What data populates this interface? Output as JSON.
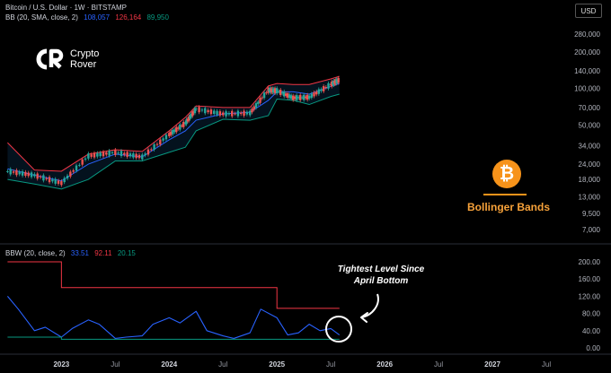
{
  "header": {
    "symbol": "Bitcoin / U.S. Dollar · 1W · BITSTAMP",
    "bb_label": "BB (20, SMA, close, 2)",
    "bb_values": [
      "108,057",
      "126,164",
      "89,950"
    ],
    "currency": "USD"
  },
  "logo": {
    "line1": "Crypto",
    "line2": "Rover"
  },
  "badge": {
    "title": "Bollinger Bands",
    "icon": "bitcoin-icon"
  },
  "annotation": {
    "line1": "Tightest Level Since",
    "line2": "April Bottom"
  },
  "colors": {
    "basis": "#2962ff",
    "upper": "#f23645",
    "lower": "#089981",
    "bbw": "#2962ff",
    "orange": "#f7931a"
  },
  "chart_data": [
    {
      "type": "line",
      "title": "Bitcoin / U.S. Dollar · 1W · BITSTAMP",
      "scale": "log",
      "y_ticks": [
        7000,
        9500,
        13000,
        18000,
        24000,
        34000,
        50000,
        70000,
        100000,
        140000,
        200000,
        280000
      ],
      "y_tick_labels": [
        "7,000",
        "9,500",
        "13,000",
        "18,000",
        "24,000",
        "34,000",
        "50,000",
        "70,000",
        "100,000",
        "140,000",
        "200,000",
        "280,000"
      ],
      "x_tick_labels": [
        "2023",
        "Jul",
        "2024",
        "Jul",
        "2025",
        "Jul",
        "2026",
        "Jul",
        "2027",
        "Jul"
      ],
      "x": [
        2022.5,
        2022.75,
        2023.0,
        2023.25,
        2023.5,
        2023.75,
        2024.0,
        2024.15,
        2024.25,
        2024.5,
        2024.75,
        2024.92,
        2025.0,
        2025.15,
        2025.3,
        2025.5,
        2025.58
      ],
      "series": [
        {
          "name": "close",
          "values": [
            21000,
            19500,
            16800,
            28000,
            30000,
            27500,
            42000,
            52000,
            68000,
            62000,
            63000,
            97000,
            96000,
            84000,
            85000,
            108000,
            118000
          ]
        },
        {
          "name": "BB basis",
          "values": [
            22000,
            19500,
            17500,
            24000,
            29000,
            27500,
            38000,
            45000,
            55000,
            62000,
            64000,
            80000,
            94000,
            94000,
            90000,
            104000,
            110000
          ]
        },
        {
          "name": "BB upper",
          "values": [
            36000,
            21500,
            21000,
            29000,
            31500,
            30500,
            45000,
            58000,
            72000,
            70000,
            70000,
            105000,
            110000,
            108000,
            108000,
            120000,
            126000
          ]
        },
        {
          "name": "BB lower",
          "values": [
            18000,
            16500,
            15000,
            18000,
            25500,
            25500,
            30000,
            33000,
            45000,
            56000,
            55000,
            60000,
            82000,
            80000,
            74000,
            86000,
            90000
          ]
        }
      ]
    },
    {
      "type": "line",
      "title": "BBW (20, close, 2)",
      "values_shown": [
        "33.51",
        "92.11",
        "20.15"
      ],
      "y_ticks": [
        0,
        40,
        80,
        120,
        160,
        200
      ],
      "y_tick_labels": [
        "0.00",
        "40.00",
        "80.00",
        "120.00",
        "160.00",
        "200.00"
      ],
      "x": [
        2022.5,
        2022.6,
        2022.75,
        2022.85,
        2023.0,
        2023.1,
        2023.25,
        2023.35,
        2023.5,
        2023.6,
        2023.75,
        2023.85,
        2024.0,
        2024.1,
        2024.25,
        2024.35,
        2024.5,
        2024.6,
        2024.75,
        2024.85,
        2025.0,
        2025.1,
        2025.2,
        2025.3,
        2025.4,
        2025.5,
        2025.58
      ],
      "series": [
        {
          "name": "BBW",
          "values": [
            120,
            90,
            40,
            48,
            25,
            45,
            65,
            55,
            22,
            25,
            28,
            55,
            70,
            58,
            85,
            40,
            28,
            22,
            35,
            90,
            70,
            30,
            35,
            55,
            40,
            45,
            30
          ]
        },
        {
          "name": "highest",
          "values": [
            200,
            200,
            200,
            200,
            140,
            140,
            140,
            140,
            140,
            140,
            140,
            140,
            140,
            140,
            140,
            140,
            140,
            140,
            140,
            140,
            92,
            92,
            92,
            92,
            92,
            92,
            92
          ]
        },
        {
          "name": "lowest",
          "values": [
            25,
            25,
            25,
            25,
            20,
            20,
            20,
            20,
            20,
            20,
            20,
            20,
            20,
            20,
            20,
            20,
            20,
            20,
            20,
            20,
            20,
            20,
            20,
            20,
            20,
            20,
            20
          ]
        }
      ]
    }
  ]
}
